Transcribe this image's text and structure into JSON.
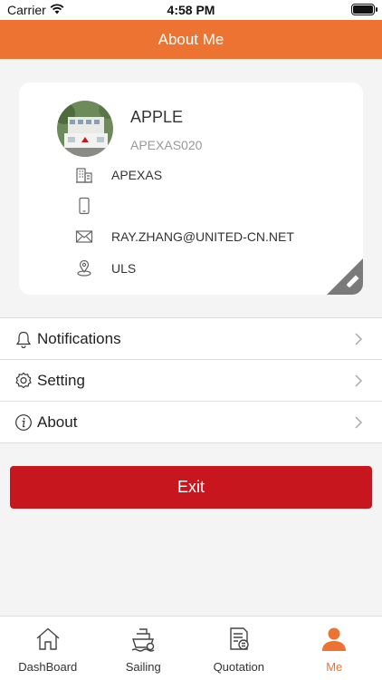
{
  "status_bar": {
    "carrier": "Carrier",
    "time": "4:58 PM"
  },
  "header": {
    "title": "About Me"
  },
  "profile": {
    "name": "APPLE",
    "code": "APEXAS020",
    "company": "APEXAS",
    "phone": "",
    "email": "RAY.ZHANG@UNITED-CN.NET",
    "location": "ULS"
  },
  "menu": {
    "items": [
      {
        "label": "Notifications",
        "icon": "bell-icon"
      },
      {
        "label": "Setting",
        "icon": "gear-icon"
      },
      {
        "label": "About",
        "icon": "info-icon"
      }
    ]
  },
  "exit_label": "Exit",
  "tabs": [
    {
      "label": "DashBoard",
      "icon": "home-icon"
    },
    {
      "label": "Sailing",
      "icon": "ship-icon"
    },
    {
      "label": "Quotation",
      "icon": "quotation-icon"
    },
    {
      "label": "Me",
      "icon": "person-icon",
      "active": true
    }
  ],
  "colors": {
    "brand": "#ed7332",
    "exit": "#c8161e"
  }
}
